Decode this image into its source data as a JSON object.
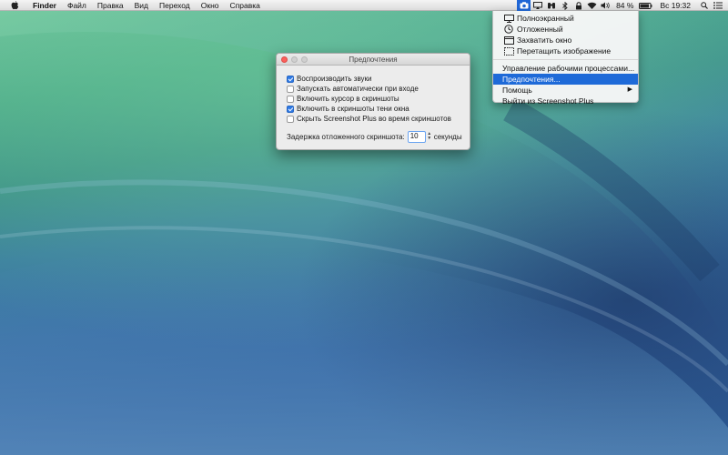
{
  "menubar": {
    "apple_icon": "apple-logo-icon",
    "items": [
      "Finder",
      "Файл",
      "Правка",
      "Вид",
      "Переход",
      "Окно",
      "Справка"
    ],
    "status": {
      "icons": [
        "screenshot-plus-icon",
        "display-mirror-icon",
        "binoculars-icon",
        "bluetooth-icon",
        "lock-icon",
        "wifi-icon",
        "volume-icon",
        "battery-icon",
        "spotlight-icon",
        "notification-center-icon"
      ],
      "battery_percent": "84 %",
      "clock": "Вс 19:32"
    }
  },
  "status_menu": {
    "capture_items": [
      {
        "label": "Полноэкранный",
        "icon": "monitor-icon"
      },
      {
        "label": "Отложенный",
        "icon": "clock-icon"
      },
      {
        "label": "Захватить окно",
        "icon": "window-icon"
      },
      {
        "label": "Перетащить изображение",
        "icon": "dashed-rect-icon"
      }
    ],
    "other_items": [
      {
        "label": "Управление рабочими процессами..."
      },
      {
        "label": "Предпочтения...",
        "selected": true
      },
      {
        "label": "Помощь",
        "submenu": true
      },
      {
        "label": "Выйти из Screenshot Plus"
      }
    ]
  },
  "prefs_window": {
    "title": "Предпочтения",
    "options": [
      {
        "label": "Воспроизводить звуки",
        "checked": true
      },
      {
        "label": "Запускать автоматически при входе",
        "checked": false
      },
      {
        "label": "Включить курсор в скриншоты",
        "checked": false
      },
      {
        "label": "Включить в скриншоты тени окна",
        "checked": true
      },
      {
        "label": "Скрыть Screenshot Plus во время скриншотов",
        "checked": false
      }
    ],
    "delay_label": "Задержка отложенного скриншота:",
    "delay_value": "10",
    "delay_units": "секунды"
  },
  "colors": {
    "accent": "#1e6ad8",
    "checkbox_on": "#2f7ae5",
    "close_button": "#fc605c"
  }
}
